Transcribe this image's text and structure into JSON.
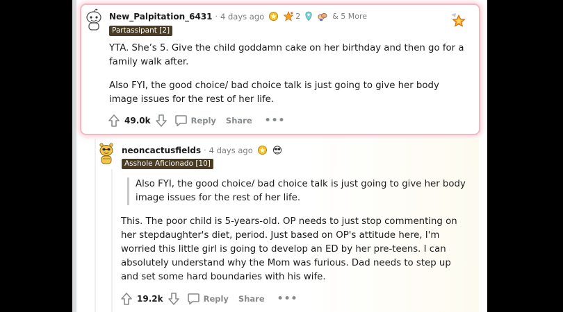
{
  "comments": [
    {
      "username": "New_Palpitation_6431",
      "time": "4 days ago",
      "award_count": "2",
      "more_awards": "& 5 More",
      "flair": "Partassipant [2]",
      "paragraphs": [
        "YTA. She’s 5. Give the child goddamn cake on her birthday and then go for a family walk after.",
        "Also FYI, the good choice/ bad choice talk is just going to give her body image issues for the rest of her life."
      ],
      "votes": "49.0k",
      "reply_label": "Reply",
      "share_label": "Share",
      "more_label": "•••"
    },
    {
      "username": "neoncactusfields",
      "time": "4 days ago",
      "flair": "Asshole Aficionado [10]",
      "quote": "Also FYI, the good choice/ bad choice talk is just going to give her body image issues for the rest of her life.",
      "paragraph": "This. The poor child is 5-years-old. OP needs to just stop commenting on her stepdaughter's diet, period. Just based on OP's attitude here, I'm worried this little girl is going to develop an ED by her pre-teens. I can absolutely understand why the Mom was furious. Dad needs to step up and set some hard boundaries with his wife.",
      "votes": "19.2k",
      "reply_label": "Reply",
      "share_label": "Share",
      "more_label": "•••"
    }
  ],
  "colors": {
    "highlight_glow": "#f6b8bf",
    "flair_bg": "#4a3b23",
    "meta_gray": "#7c7c7c",
    "action_gray": "#878a8c",
    "text": "#1c1c1c"
  },
  "icons": [
    "snoo-avatar-icon",
    "gold-award-icon",
    "star-award-icon",
    "location-award-icon",
    "hands-award-icon",
    "upvote-icon",
    "downvote-icon",
    "comment-icon",
    "more-options-icon",
    "highlight-badge-icon"
  ]
}
